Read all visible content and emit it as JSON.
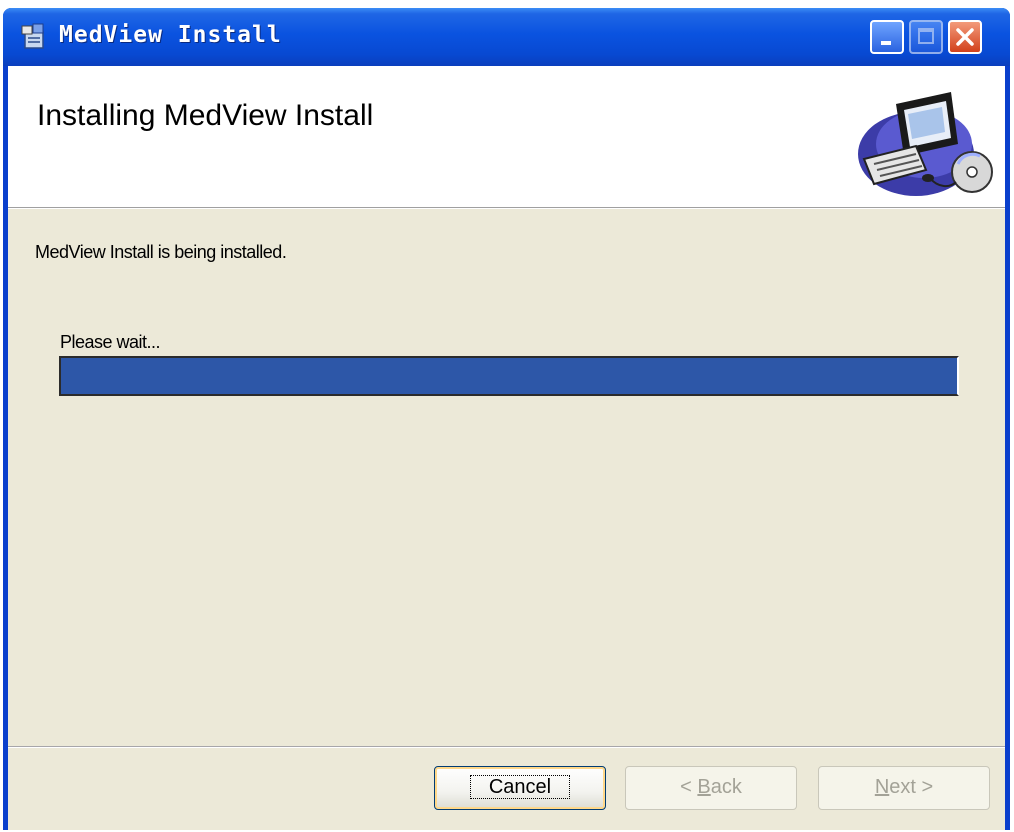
{
  "window": {
    "title": "MedView Install"
  },
  "banner": {
    "title": "Installing MedView Install"
  },
  "main": {
    "status_text": "MedView Install is being installed.",
    "wait_text": "Please wait...",
    "progress_fraction": 1.0
  },
  "buttons": {
    "cancel_label": "Cancel",
    "back_prefix": "< ",
    "back_accel": "B",
    "back_rest": "ack",
    "next_accel": "N",
    "next_rest": "ext >"
  },
  "colors": {
    "titlebar": "#0a53e0",
    "progress_fill": "#2d57a8",
    "dialog_bg": "#ece9d8"
  },
  "icons": {
    "app": "installer-icon",
    "minimize": "minimize-icon",
    "maximize": "maximize-icon",
    "close": "close-icon",
    "banner": "computer-cd-icon"
  }
}
